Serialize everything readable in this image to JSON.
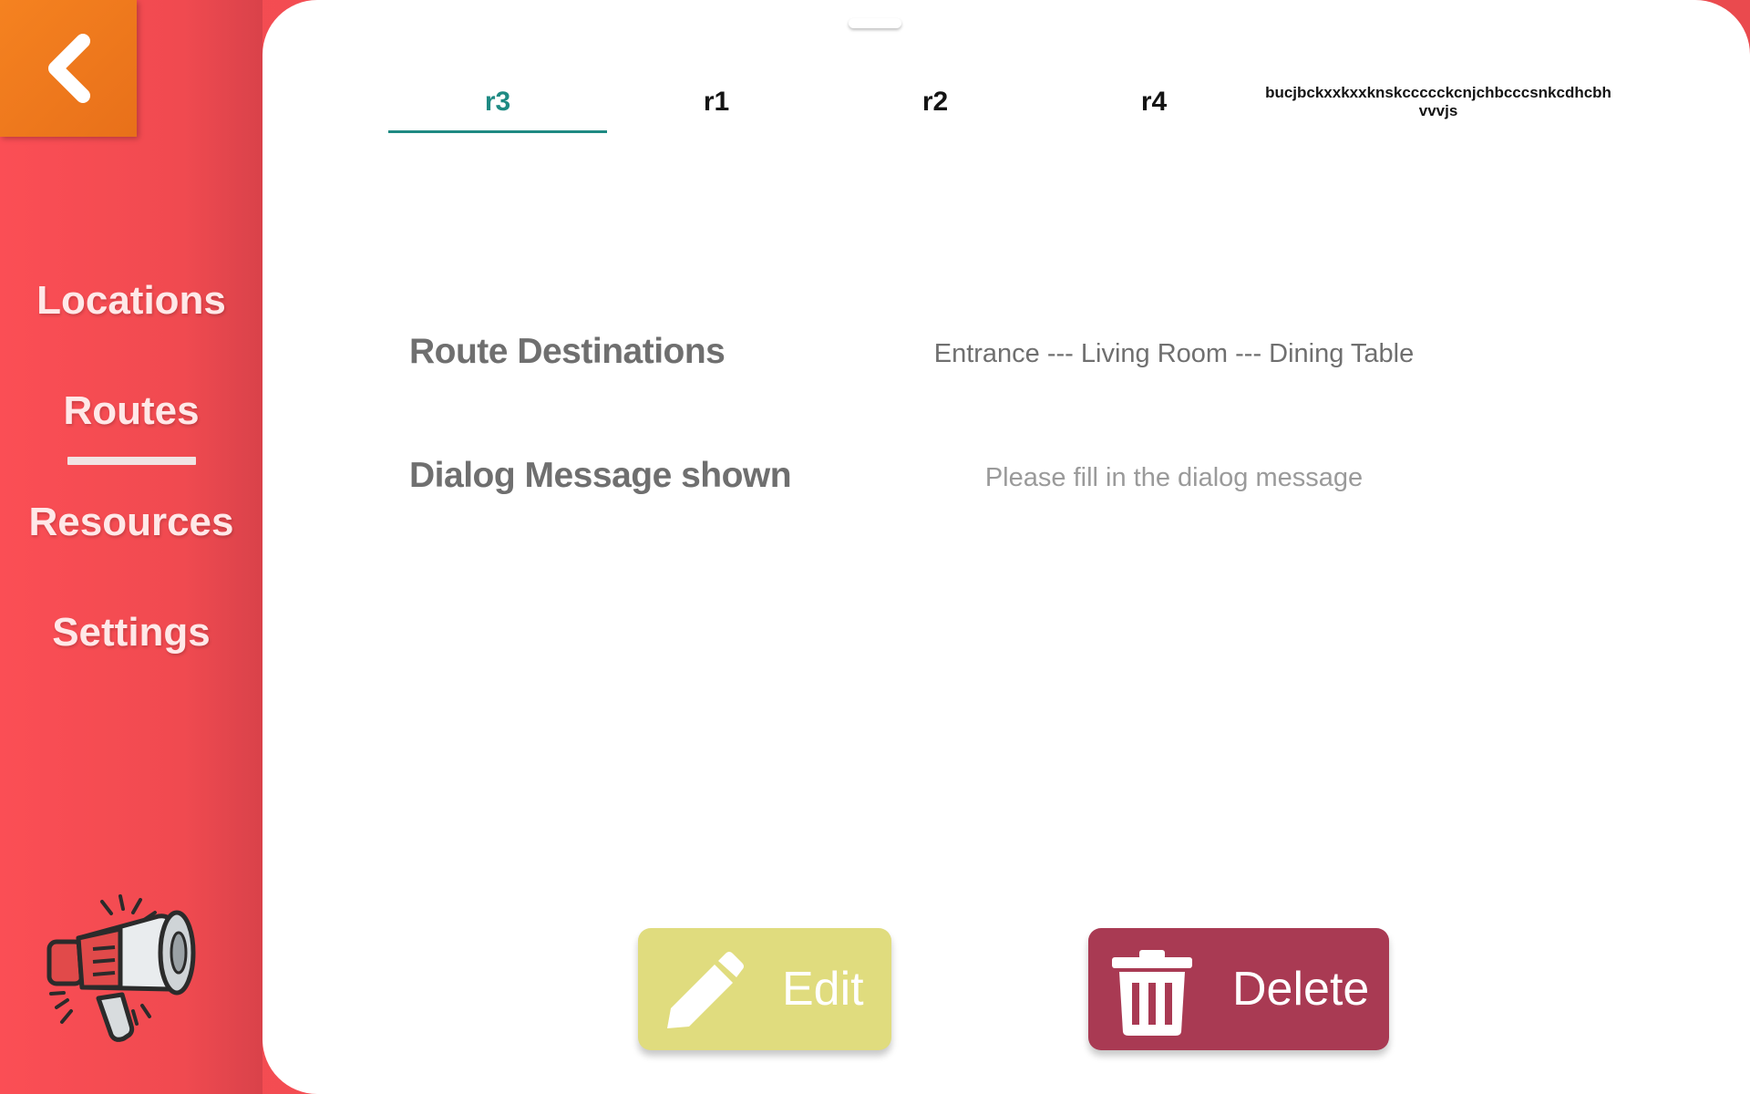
{
  "sidebar": {
    "back_icon": "chevron-left-icon",
    "items": [
      {
        "label": "Locations"
      },
      {
        "label": "Routes",
        "active": true
      },
      {
        "label": "Resources"
      },
      {
        "label": "Settings"
      }
    ],
    "footer_icon": "megaphone-icon"
  },
  "tabs": [
    {
      "label": "r3",
      "active": true
    },
    {
      "label": "r1"
    },
    {
      "label": "r2"
    },
    {
      "label": "r4"
    },
    {
      "label": "bucjbckxxkxxknskccccckcnjchbcccsnkcdhcbh vvvjs"
    }
  ],
  "details": {
    "route_destinations_label": "Route Destinations",
    "route_destinations_value": "Entrance --- Living Room --- Dining Table",
    "dialog_message_label": "Dialog Message shown",
    "dialog_message_placeholder": "Please fill in the dialog message"
  },
  "actions": {
    "edit_label": "Edit",
    "edit_icon": "pencil-icon",
    "delete_label": "Delete",
    "delete_icon": "trash-icon"
  },
  "colors": {
    "accent": "#1e8a83",
    "sidebar": "#f54d53",
    "back_button": "#f58220",
    "edit_button": "#e0dc7e",
    "delete_button": "#a93a53"
  }
}
